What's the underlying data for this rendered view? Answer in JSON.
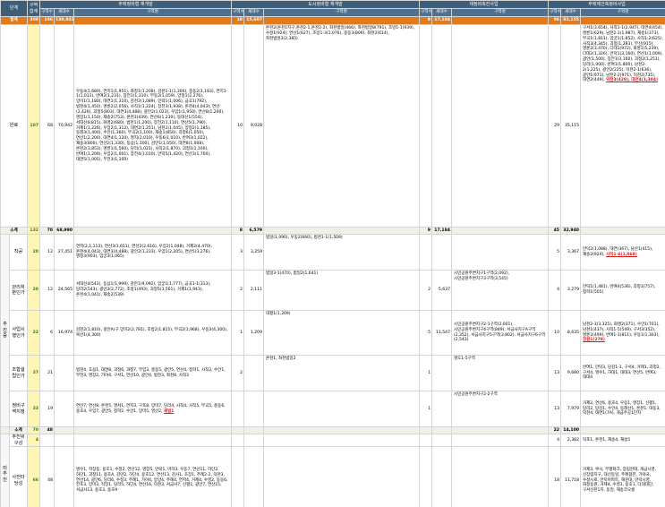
{
  "headers": {
    "col_group": "단계",
    "col_count": "구역합계",
    "sec1": "주택정비형 재개발",
    "sec2": "도시정비형 재개발",
    "sec3": "재정비촉진사업",
    "sec4": "주택재건축정비사업",
    "sub_count": "구역수",
    "sub_households": "세대수",
    "sub_name": "구역명"
  },
  "total": {
    "label": "합계",
    "count": "309",
    "s1_count": "186",
    "s1_hh": "139,932",
    "s2_count": "18",
    "s2_hh": "15,607",
    "s3_count": "9",
    "s3_hh": "17,184",
    "s4_count": "96",
    "s4_hh": "82,155"
  },
  "completed": {
    "label": "완료",
    "count": "107",
    "s1_count": "68",
    "s1_hh": "70,942",
    "s1_list": "우동4(1,680), 연지1(1,951), 화정1(1,208), 감천1-1(1,300), 중동2(1,183), 연지1-1(1,011), 반여2(1,231), 장전1(1,310), 부동2(1,059), 양정1(2,276), 망미1(1,180), 대연1(1,310), 감천2(1,089), 민락1(1,006), 금곡1(792), 범천4(1,450), 명륜2(2,056), 사직1(1,224), 장전3(1,938), 온천4(4,043), 연산(2,426), 괴정5(803), 대연3(4,488), 광안2(1,023), 우암1(1,950), 연산8(1,200), 명장1(1,150), 재송2(753), 온천3(439), 연산6(1,230), 동대신1(554), 서대신6(815), 화명2(680), 범천1(1,200), 장전2(1,110), 연산5(1,790), 거제1(1,226), 우장2(1,312), 대연2(1,251), 남천2(1,045), 양정2(1,185), 동래3(1,400), 수안(1,360), 부곡2(1,100), 재송1(850), 괴정6(1,050), 연산1(2,200), 대연4(1,120), 명지(2,010), 우동6(1,010), 반여3(1,022), 재송3(800), 연산2(1,330), 동삼(1,100), 감만1(1,050), 대연8(1,008), 온천2(3,853), 명륜1(1,560), 당리(1,021), 사직2(1,870), 괴정1(1,100), 반여1(1,209), 우암2(1,001), 장전4(1,010), 만덕5(1,420), 연산3(1,700), 대연5(1,005), 부전3(1,100)",
    "s2_count": "10",
    "s2_hh": "9,028",
    "s2_list": "온천2(온천1지구,온천2-1,온천2-2), 좌천범일(466), 좌천범일8(791), 조방1-1(939), 수정1(924), 연산1(627), 조방1-3(1,076), 중동3(806), 좌천2(614), 좌천범일3(2,385)",
    "s4_count": "29",
    "s4_hh": "35,115",
    "s4_list_a": "구서1(3,654), 사직1-1(2,947), 대연4(454), 명륜1(629), 남천2-1(1,987), 재송1(373), 부곡1(1,811), 엄궁1(1,852), 사직1-2(625), 사직3(4,345), 괴정(1,283), 부산(915), 명륜2(3,470), 다대1(972), 화명1(5,239), 다대2(1,326), 만덕1(3,160), 연산1(1,009), 광안(1,500), 장전1(3,160), 괴정2(1,251), 당리(1,000), 반여1(1,800), 남천2-2(1,225), 광안2(225), 덕천2-1(636), 광안1(971), 남천2-2(971), 덕천2(735), 대연2(449), ",
    "s4_list_hl": "덕천3(429), 대연4(1,384)"
  },
  "subtotal1": {
    "label": "소계",
    "count": "132",
    "s1_count": "70",
    "s1_hh": "68,990",
    "s2_count": "8",
    "s2_hh": "6,579",
    "s3_count": "9",
    "s3_hh": "17,184",
    "s4_count": "45",
    "s4_hh": "32,940"
  },
  "ongoing_group": "추진중",
  "rows": [
    {
      "stage": "착공",
      "count": "20",
      "s1_count": "12",
      "s1_hh": "27,451",
      "s1_list": "연지(2,1,113), 연산3(1,651), 연산2(2,616), 우암2(1,048), 거제2(4,470), 온천4(4,043), 대연3(4,488), 광안2(1,233), 우암1(2,205), 연산5(3,276), 명정3(903), 엄궁3(1,065)",
      "s2_count": "3",
      "s2_hh": "3,259",
      "s2_list": "범일(1,090), 우동2(660), 범천1-1(1,509)",
      "s3_count": "",
      "s3_hh": "",
      "s3_list": "",
      "s4_count": "5",
      "s4_hh": "3,367",
      "s4_list": "만덕2(1,088), 대연(367), 남산1(415), 재송2(924), ",
      "s4_hl": "사직1-6(1,068)"
    },
    {
      "stage": "관리처분인가",
      "count": "20",
      "s1_count": "12",
      "s1_hh": "24,565",
      "s1_list": "서대신4(542), 동삼1(1,999), 감만1(9,092), 엄궁1(1,777), 금곡1-1(313), 당리2(543), 광안3(2,772), 조방1(493), 괴정5(3,561), 거제1(1,943), 온천4(1,041), 재송2(539)",
      "s2_count": "2",
      "s2_hh": "2,111",
      "s2_list": "범일3-1(470), 범일2(1,641)",
      "s3_count": "2",
      "s3_hh": "5,637",
      "s3_list": "시민공원주변지구1구역(2,092), 시민공원주변지구3구역(3,545)",
      "s4_count": "4",
      "s4_hh": "3,279",
      "s4_list": "만덕1(1,481), 반여4(536), 괴정3(757), 정학1(505)",
      "s4_hl": ""
    },
    {
      "stage": "사업시행인가",
      "count": "22",
      "s1_count": "6",
      "s1_hh": "16,974",
      "s1_list": "감천2(1,810), 광안A(구 망미2(2,781), 조방2(1,815), 부곡2(1,968), 우동3(4,300), 복산1(4,300)",
      "s2_count": "1",
      "s2_hh": "1,209",
      "s2_list": "대평1(1,209)",
      "s3_count": "5",
      "s3_hh": "11,547",
      "s3_list": "시민공원주변지구2-1구역(2,001), 시민공원주변지구4구역(849), 서금사지구A구역(2,352), 서금사지구5구역(3,802), 서금사지구6구역(2,543)",
      "s4_count": "10",
      "s4_hh": "8,635",
      "s4_list": "남천2-3(3,325), 화명2(371), 수안1(701), 남천1(437), 사직1-5(549), 구서3(352), 명륜2(499), 반여1-1(811), 우동1(1,303), ",
      "s4_hl": "정원1(278)"
    },
    {
      "stage": "조합설립인가",
      "count": "37",
      "s1_count": "21",
      "s1_hh": "",
      "s1_list": "범천4, 초읍1, 대연8, 괴정6, 과정7, 부암3, 충동5, 광안5, 연산4, 정학1, 사직2, 수안1, 부전3, 명장2, 가야4, 구서1, 연산10, 광안4, 범천3, 좌천8, 사직3",
      "s2_count": "2",
      "s2_hh": "",
      "s2_list": "온천1, 좌천범일2",
      "s3_count": "1",
      "s3_hh": "",
      "s3_list": "명도1-5구역",
      "s4_count": "13",
      "s4_hh": "9,680",
      "s4_list": "반여1, 만덕3, 당감1-1, 구서4, 거제1, 괴정2, 구서4, 명수1, 하대1, 대대3, 연산5, 반여3, 대대4",
      "s4_hl": ""
    },
    {
      "stage": "정비구역지정",
      "count": "33",
      "s1_count": "19",
      "s1_hh": "",
      "s1_list": "연산7, 연산8, 온천5, 명서1, 연지3, 구포8, 망미7, 당리4, 사직4, 사직5, 부곡5, 충동6, 용호4, 우암7, 광안5, 정학2, 수안1, 망미5, 영선2, ",
      "s1_hl": "괘법1",
      "s2_count": "",
      "s2_hh": "",
      "s2_list": "",
      "s3_count": "1",
      "s3_hh": "",
      "s3_list": "시민공원주변지구2-2구역",
      "s4_count": "13",
      "s4_hh": "7,979",
      "s4_list": "거제2, 연산6, 용호4, 우동1, 명장1, 신평1, 당리2, 당감1, 수안4, 동래산1, 온천1, 대동3, 덕천4, 대연1(7A), 개금주공1단지",
      "s4_hl": ""
    }
  ],
  "subtotal2": {
    "label": "소계",
    "count": "70",
    "s1_count": "48",
    "s4_count": "22",
    "s4_hh": "14,100"
  },
  "prep_row": {
    "stage": "추진위 구성",
    "count": "4",
    "s4_count": "4",
    "s4_hh": "2,382",
    "s4_list": "덕포1, 온천1, 재송4, 재송5"
  },
  "not_started_group": "미추진",
  "feasibility_row": {
    "stage": "사전타당성",
    "count": "66",
    "s1_count": "48",
    "s1_list": "명우1, 학장동, 용호1, 수정2, 연산12, 명장5, 안락1, 마하3, 우동7, 연산11, 하단2, 하단1, 괴정11, 용호A, 감만2, 하단4, 용호12, 연산13, 감사1, 초장1, 주례2-2, 덕천3, 연산14, 광안6, 당리6, 수정3, 주례1, 가야4, 망양4, 주례4, 연지4, 거제4, 수영2, 동동6, 전포3, 망미3, 학장1, 당리5, 하단4, 연산16, 덕천3, 서금사7, 신평1, 광안7, 연산15, 서금사13, 용호3, 용호9",
    "s4_count": "18",
    "s4_hh": "11,718",
    "s4_list": "거제3, 쿠시, 부평화크, 장림현대, 개금시영, 신장림지구, 대신동일, 주례협진, 가야국, 수정시로, 만덕아파트, 해운대, 만덕시영, 화정동원, 거제4, 수영1, 용호1, 다대대단, 구서신천1지, 동일, 재송코오롱"
  }
}
